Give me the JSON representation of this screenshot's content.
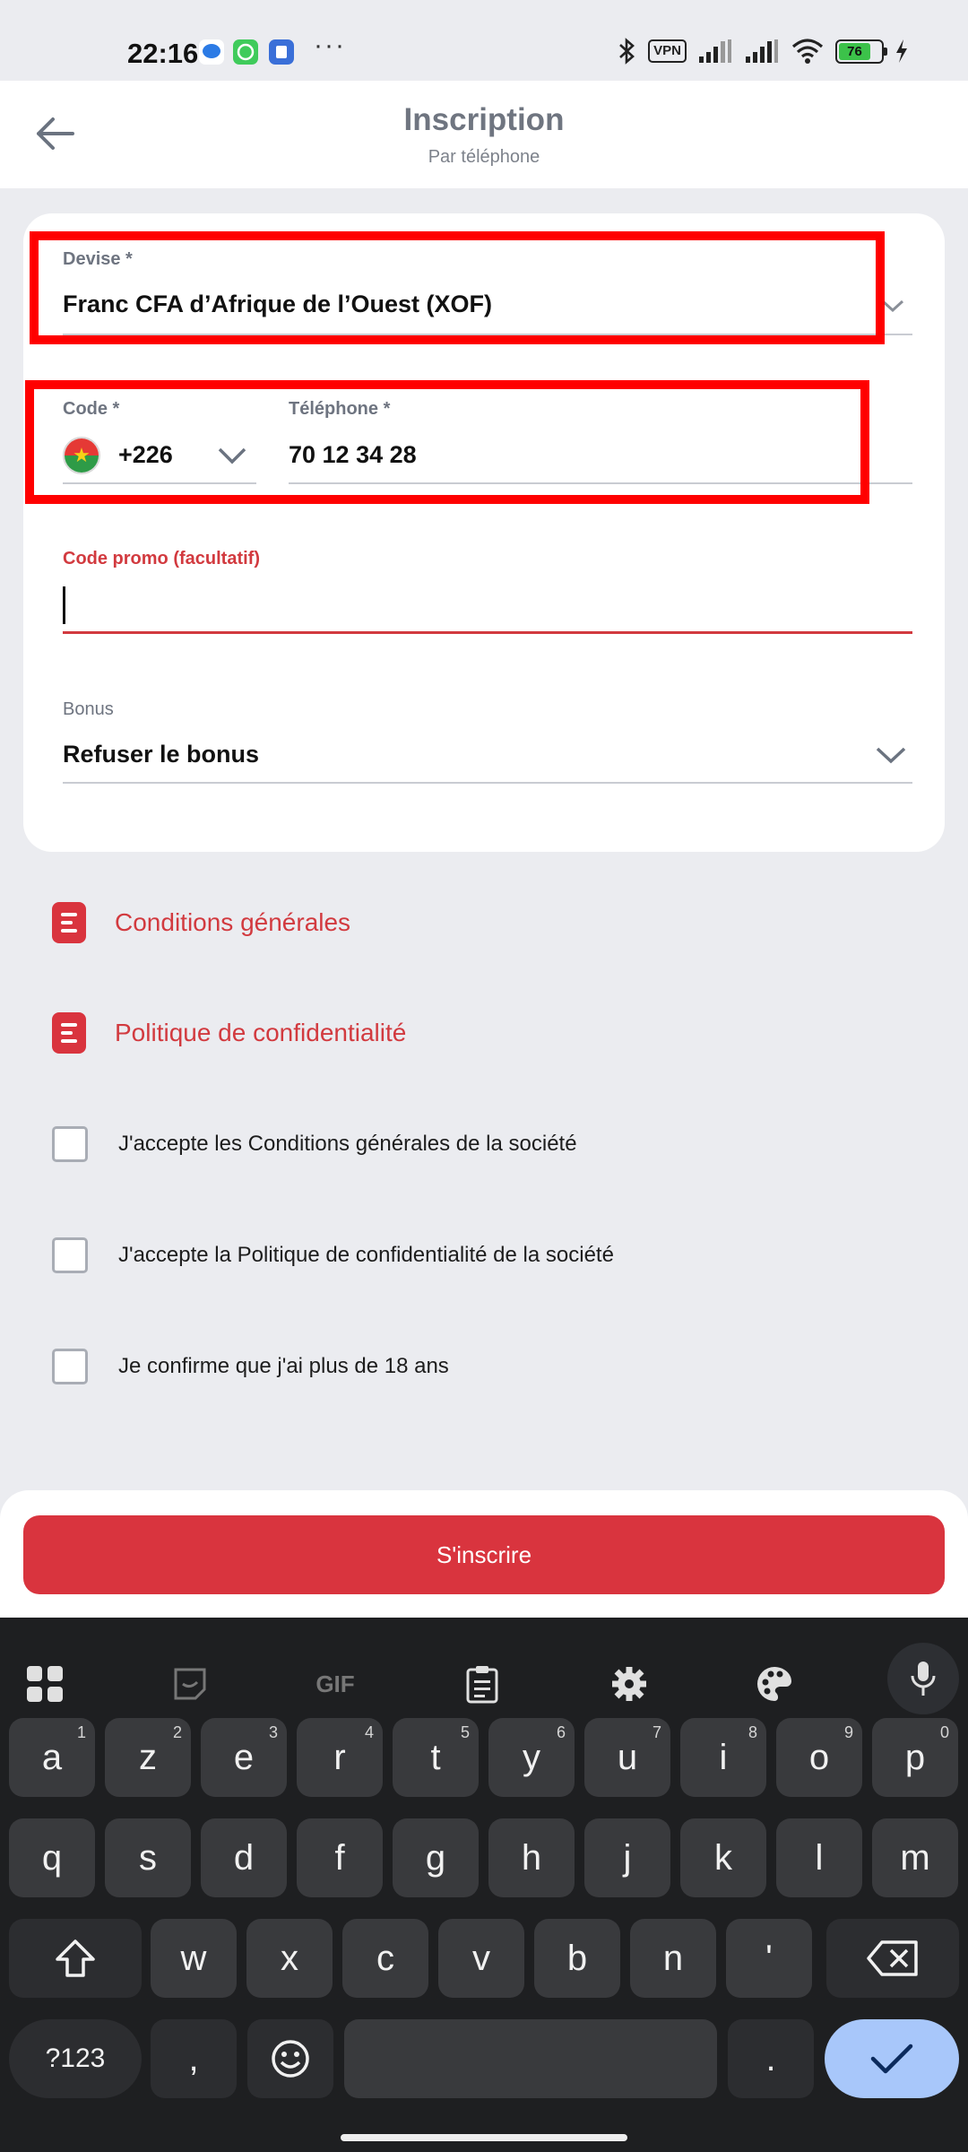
{
  "status_bar": {
    "time": "22:16",
    "dots": "···",
    "vpn": "VPN",
    "battery": "76"
  },
  "header": {
    "title": "Inscription",
    "subtitle": "Par téléphone"
  },
  "form": {
    "currency": {
      "label": "Devise *",
      "value": "Franc CFA d’Afrique de l’Ouest (XOF)"
    },
    "code": {
      "label": "Code *",
      "value": "+226"
    },
    "phone": {
      "label": "Téléphone *",
      "value": "70 12 34 28"
    },
    "promo": {
      "label": "Code promo (facultatif)",
      "value": ""
    },
    "bonus": {
      "label": "Bonus",
      "value": "Refuser le bonus"
    }
  },
  "links": [
    {
      "label": "Conditions générales"
    },
    {
      "label": "Politique de confidentialité"
    }
  ],
  "checkboxes": [
    {
      "label": "J'accepte les Conditions générales de la société",
      "checked": false
    },
    {
      "label": "J'accepte la Politique de confidentialité de la société",
      "checked": false
    },
    {
      "label": "Je confirme que j'ai plus de 18 ans",
      "checked": false
    }
  ],
  "submit_label": "S'inscrire",
  "keyboard": {
    "toolbar_gif": "GIF",
    "row1": [
      {
        "k": "a",
        "h": "1"
      },
      {
        "k": "z",
        "h": "2"
      },
      {
        "k": "e",
        "h": "3"
      },
      {
        "k": "r",
        "h": "4"
      },
      {
        "k": "t",
        "h": "5"
      },
      {
        "k": "y",
        "h": "6"
      },
      {
        "k": "u",
        "h": "7"
      },
      {
        "k": "i",
        "h": "8"
      },
      {
        "k": "o",
        "h": "9"
      },
      {
        "k": "p",
        "h": "0"
      }
    ],
    "row2": [
      "q",
      "s",
      "d",
      "f",
      "g",
      "h",
      "j",
      "k",
      "l",
      "m"
    ],
    "row3": [
      "w",
      "x",
      "c",
      "v",
      "b",
      "n",
      "'"
    ],
    "symbols": "?123",
    "comma": ",",
    "period": "."
  },
  "colors": {
    "accent": "#d9343e",
    "highlight": "#ff0000",
    "background": "#ebecf0"
  }
}
